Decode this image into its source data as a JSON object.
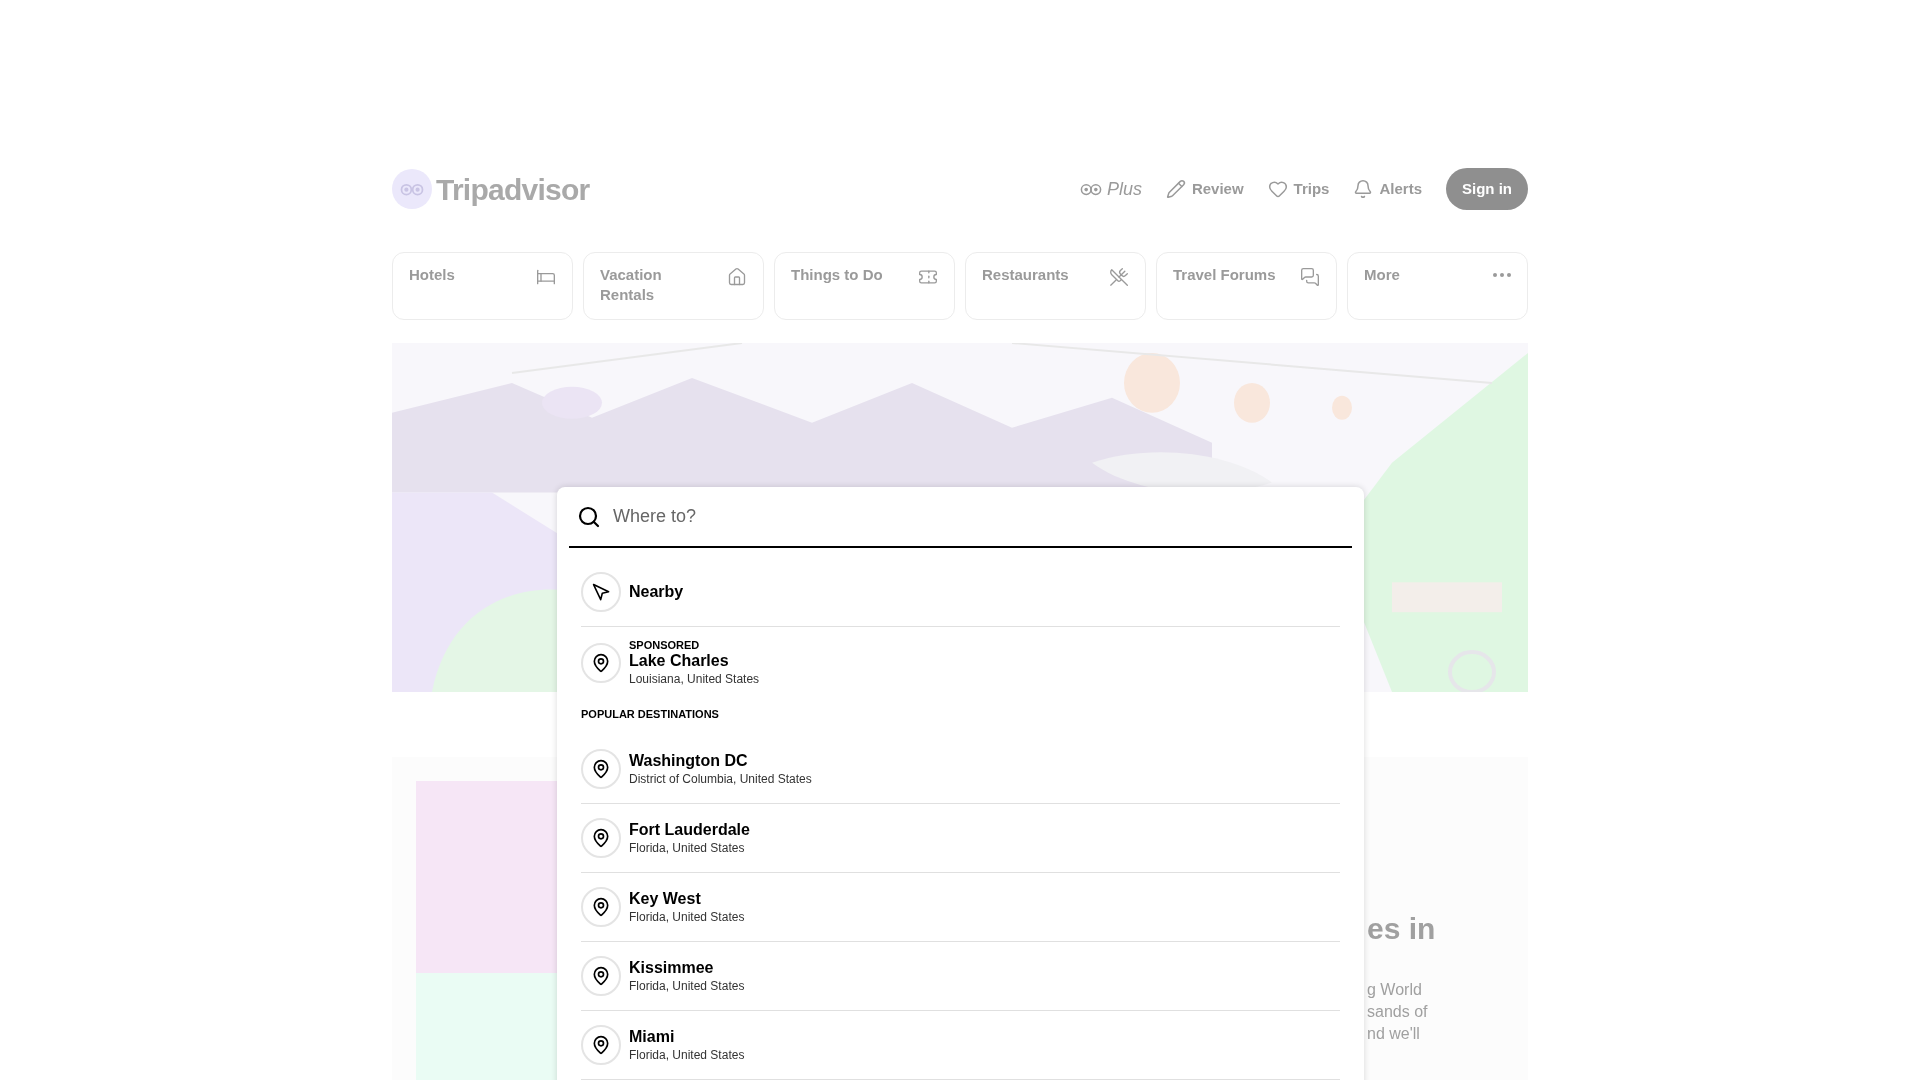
{
  "header": {
    "logo": "Tripadvisor",
    "plus": "Plus",
    "actions": [
      {
        "label": "Review"
      },
      {
        "label": "Trips"
      },
      {
        "label": "Alerts"
      }
    ],
    "sign_in": "Sign in"
  },
  "nav": [
    {
      "label": "Hotels"
    },
    {
      "label": "Vacation Rentals"
    },
    {
      "label": "Things to Do"
    },
    {
      "label": "Restaurants"
    },
    {
      "label": "Travel Forums"
    },
    {
      "label": "More"
    }
  ],
  "search": {
    "placeholder": "Where to?"
  },
  "nearby": {
    "label": "Nearby"
  },
  "sponsored": {
    "badge": "SPONSORED",
    "name": "Lake Charles",
    "region": "Louisiana, United States"
  },
  "popular_heading": "POPULAR DESTINATIONS",
  "destinations": [
    {
      "name": "Washington DC",
      "region": "District of Columbia, United States"
    },
    {
      "name": "Fort Lauderdale",
      "region": "Florida, United States"
    },
    {
      "name": "Key West",
      "region": "Florida, United States"
    },
    {
      "name": "Kissimmee",
      "region": "Florida, United States"
    },
    {
      "name": "Miami",
      "region": "Florida, United States"
    }
  ],
  "background_card": {
    "heading": "es in",
    "body": [
      "g World",
      "sands of",
      "nd we'll"
    ]
  }
}
